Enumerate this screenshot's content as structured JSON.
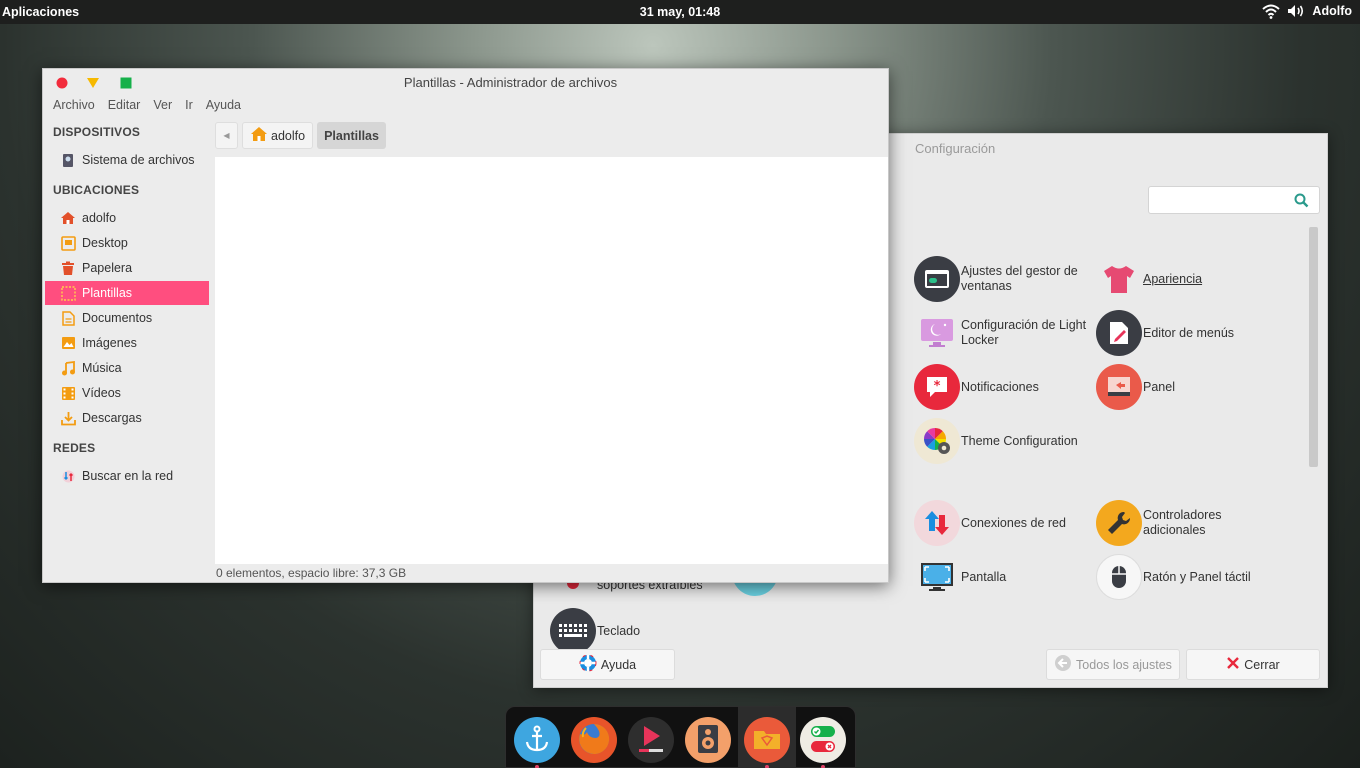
{
  "top_panel": {
    "apps_label": "Aplicaciones",
    "clock": "31 may, 01:48",
    "user": "Adolfo",
    "icons": [
      "wifi-icon",
      "volume-icon"
    ]
  },
  "settings": {
    "title": "Configuración",
    "search_placeholder": "",
    "items": {
      "window_manager": "Ajustes del gestor de ventanas",
      "appearance": "Apariencia",
      "light_locker": "Configuración de Light Locker",
      "menu_editor": "Editor de menús",
      "notifications": "Notificaciones",
      "panel": "Panel",
      "theme": "Theme Configuration",
      "network": "Conexiones de red",
      "drivers": "Controladores adicionales",
      "display": "Pantalla",
      "mouse": "Ratón y Panel táctil",
      "removable": "soportes extraíbles",
      "keyboard": "Teclado"
    },
    "help_button": "Ayuda",
    "all_settings_button": "Todos los ajustes",
    "close_button": "Cerrar"
  },
  "filemgr": {
    "title": "Plantillas - Administrador de archivos",
    "menu": [
      "Archivo",
      "Editar",
      "Ver",
      "Ir",
      "Ayuda"
    ],
    "sections": {
      "devices": "DISPOSITIVOS",
      "places": "UBICACIONES",
      "network": "REDES"
    },
    "devices": [
      {
        "label": "Sistema de archivos",
        "icon": "drive-icon"
      }
    ],
    "places": [
      {
        "label": "adolfo",
        "icon": "home-icon"
      },
      {
        "label": "Desktop",
        "icon": "desktop-icon"
      },
      {
        "label": "Papelera",
        "icon": "trash-icon"
      },
      {
        "label": "Plantillas",
        "icon": "templates-icon"
      },
      {
        "label": "Documentos",
        "icon": "documents-icon"
      },
      {
        "label": "Imágenes",
        "icon": "pictures-icon"
      },
      {
        "label": "Música",
        "icon": "music-icon"
      },
      {
        "label": "Vídeos",
        "icon": "videos-icon"
      },
      {
        "label": "Descargas",
        "icon": "downloads-icon"
      }
    ],
    "network_items": [
      {
        "label": "Buscar en la red",
        "icon": "network-icon"
      }
    ],
    "path": {
      "home": "adolfo",
      "current": "Plantillas"
    },
    "status": "0 elementos, espacio libre: 37,3 GB"
  },
  "colors": {
    "accent": "#ff4e7f",
    "close": "#f22c3c",
    "minimize": "#f6b900",
    "maximize": "#16b04a"
  },
  "dock": [
    "anchor-icon",
    "firefox-icon",
    "media-player-icon",
    "speaker-icon",
    "file-manager-icon",
    "settings-toggle-icon"
  ]
}
